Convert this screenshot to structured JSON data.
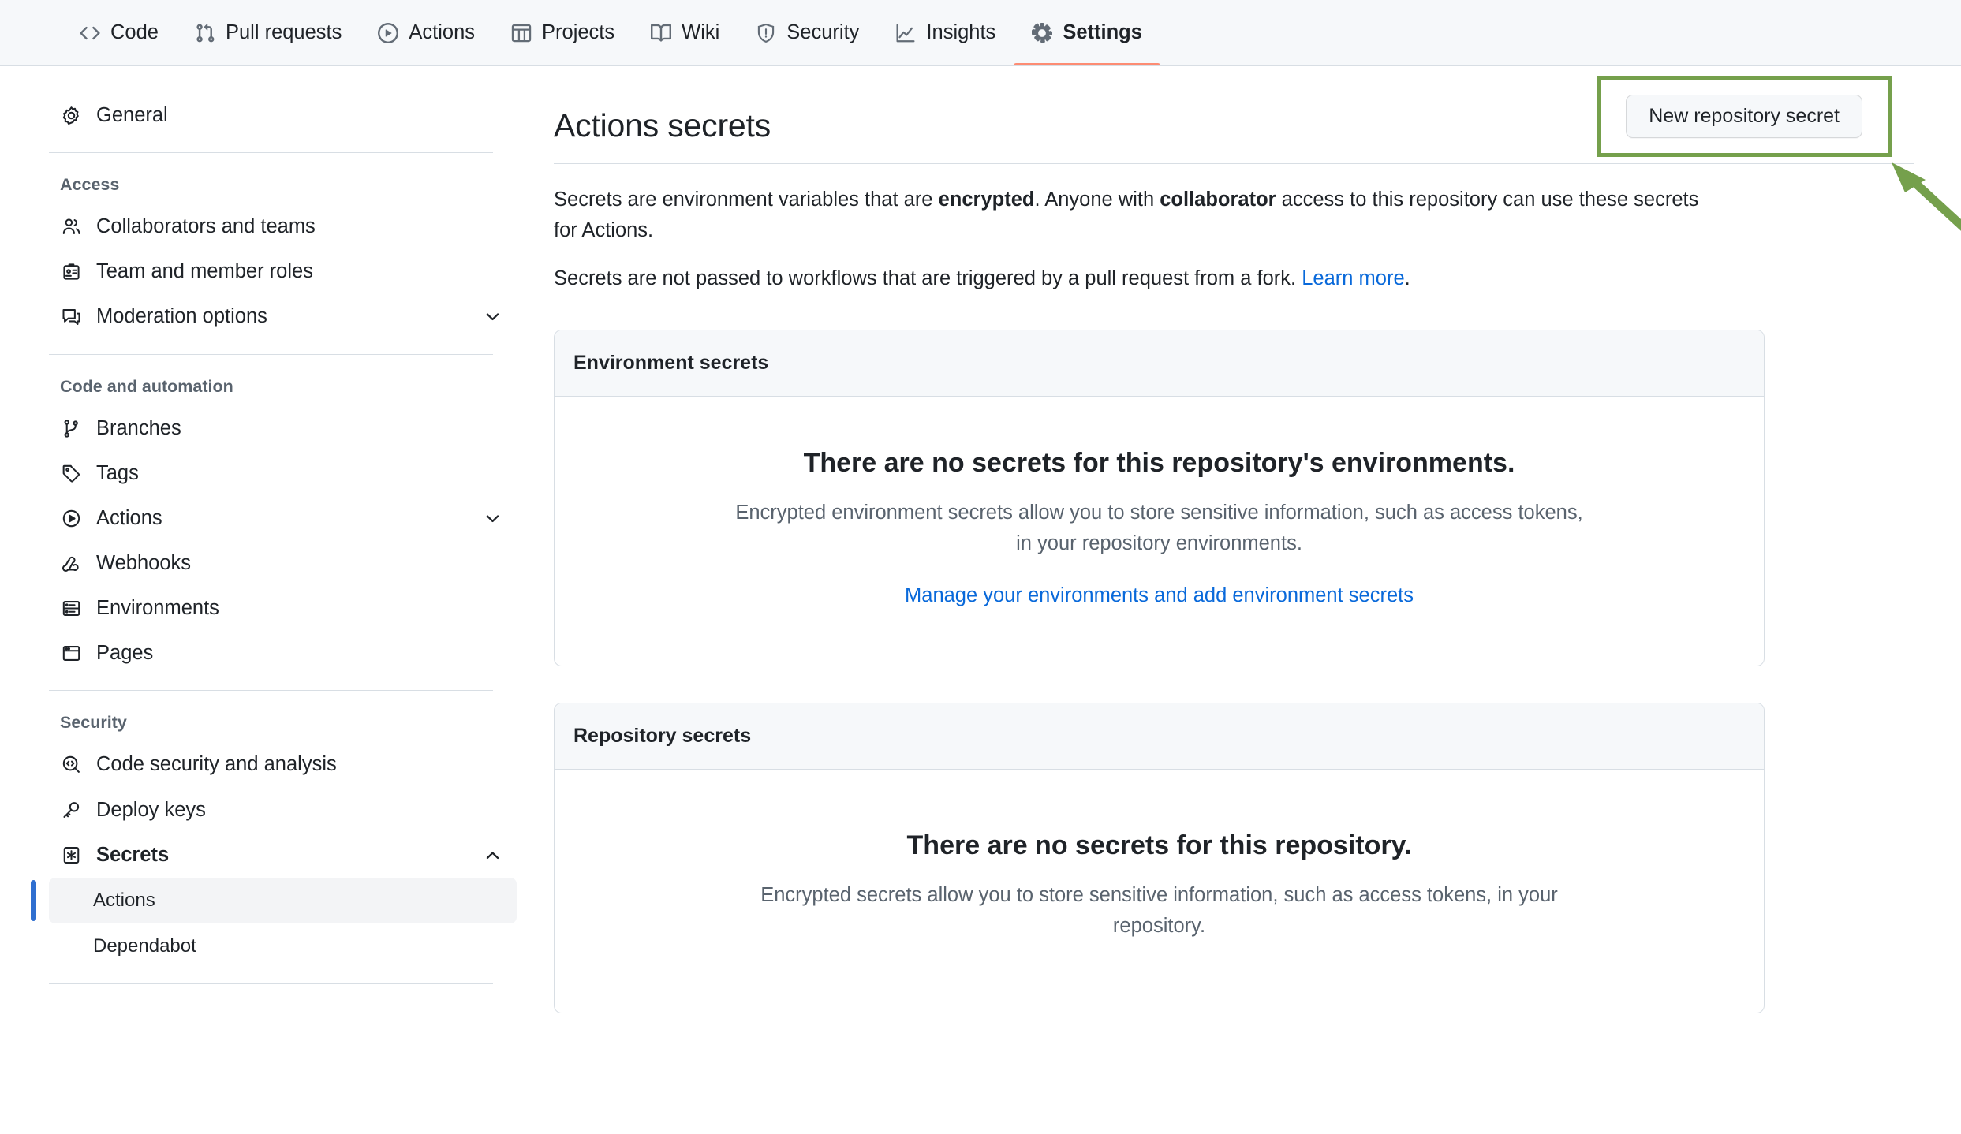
{
  "repo_nav": {
    "tabs": [
      {
        "label": "Code",
        "icon": "code-icon",
        "active": false
      },
      {
        "label": "Pull requests",
        "icon": "git-pull-request-icon",
        "active": false
      },
      {
        "label": "Actions",
        "icon": "play-circle-icon",
        "active": false
      },
      {
        "label": "Projects",
        "icon": "table-icon",
        "active": false
      },
      {
        "label": "Wiki",
        "icon": "book-icon",
        "active": false
      },
      {
        "label": "Security",
        "icon": "shield-alert-icon",
        "active": false
      },
      {
        "label": "Insights",
        "icon": "graph-icon",
        "active": false
      },
      {
        "label": "Settings",
        "icon": "gear-icon",
        "active": true
      }
    ],
    "active_underline_color": "#fd8c73"
  },
  "sidebar": {
    "top_item": {
      "label": "General",
      "icon": "gear-icon"
    },
    "sections": [
      {
        "title": "Access",
        "items": [
          {
            "label": "Collaborators and teams",
            "icon": "people-icon",
            "chevron": ""
          },
          {
            "label": "Team and member roles",
            "icon": "id-badge-icon",
            "chevron": ""
          },
          {
            "label": "Moderation options",
            "icon": "comment-discussion-icon",
            "chevron": "down"
          }
        ]
      },
      {
        "title": "Code and automation",
        "items": [
          {
            "label": "Branches",
            "icon": "git-branch-icon",
            "chevron": ""
          },
          {
            "label": "Tags",
            "icon": "tag-icon",
            "chevron": ""
          },
          {
            "label": "Actions",
            "icon": "play-circle-icon",
            "chevron": "down"
          },
          {
            "label": "Webhooks",
            "icon": "webhook-icon",
            "chevron": ""
          },
          {
            "label": "Environments",
            "icon": "server-icon",
            "chevron": ""
          },
          {
            "label": "Pages",
            "icon": "browser-icon",
            "chevron": ""
          }
        ]
      },
      {
        "title": "Security",
        "items": [
          {
            "label": "Code security and analysis",
            "icon": "codescan-icon",
            "chevron": ""
          },
          {
            "label": "Deploy keys",
            "icon": "key-icon",
            "chevron": ""
          },
          {
            "label": "Secrets",
            "icon": "asterisk-key-icon",
            "chevron": "up",
            "bold": true
          }
        ],
        "subitems": [
          {
            "label": "Actions",
            "selected": true
          },
          {
            "label": "Dependabot",
            "selected": false
          }
        ]
      }
    ],
    "accent_color": "#2f6fd0",
    "selected_bg": "#f3f4f6"
  },
  "main": {
    "title": "Actions secrets",
    "new_secret_button": "New repository secret",
    "description_1": {
      "part1": "Secrets are environment variables that are ",
      "bold1": "encrypted",
      "part2": ". Anyone with ",
      "bold2": "collaborator",
      "part3": " access to this repository can use these secrets for Actions."
    },
    "description_2": {
      "text": "Secrets are not passed to workflows that are triggered by a pull request from a fork. ",
      "link": "Learn more",
      "suffix": "."
    },
    "cards": [
      {
        "header": "Environment secrets",
        "empty_title": "There are no secrets for this repository's environments.",
        "empty_sub": "Encrypted environment secrets allow you to store sensitive information, such as access tokens, in your repository environments.",
        "link": "Manage your environments and add environment secrets"
      },
      {
        "header": "Repository secrets",
        "empty_title": "There are no secrets for this repository.",
        "empty_sub": "Encrypted secrets allow you to store sensitive information, such as access tokens, in your repository.",
        "link": ""
      }
    ]
  },
  "annotation": {
    "color": "#75a04c",
    "shape": "rectangle-highlight-with-arrow",
    "target": "New repository secret"
  }
}
